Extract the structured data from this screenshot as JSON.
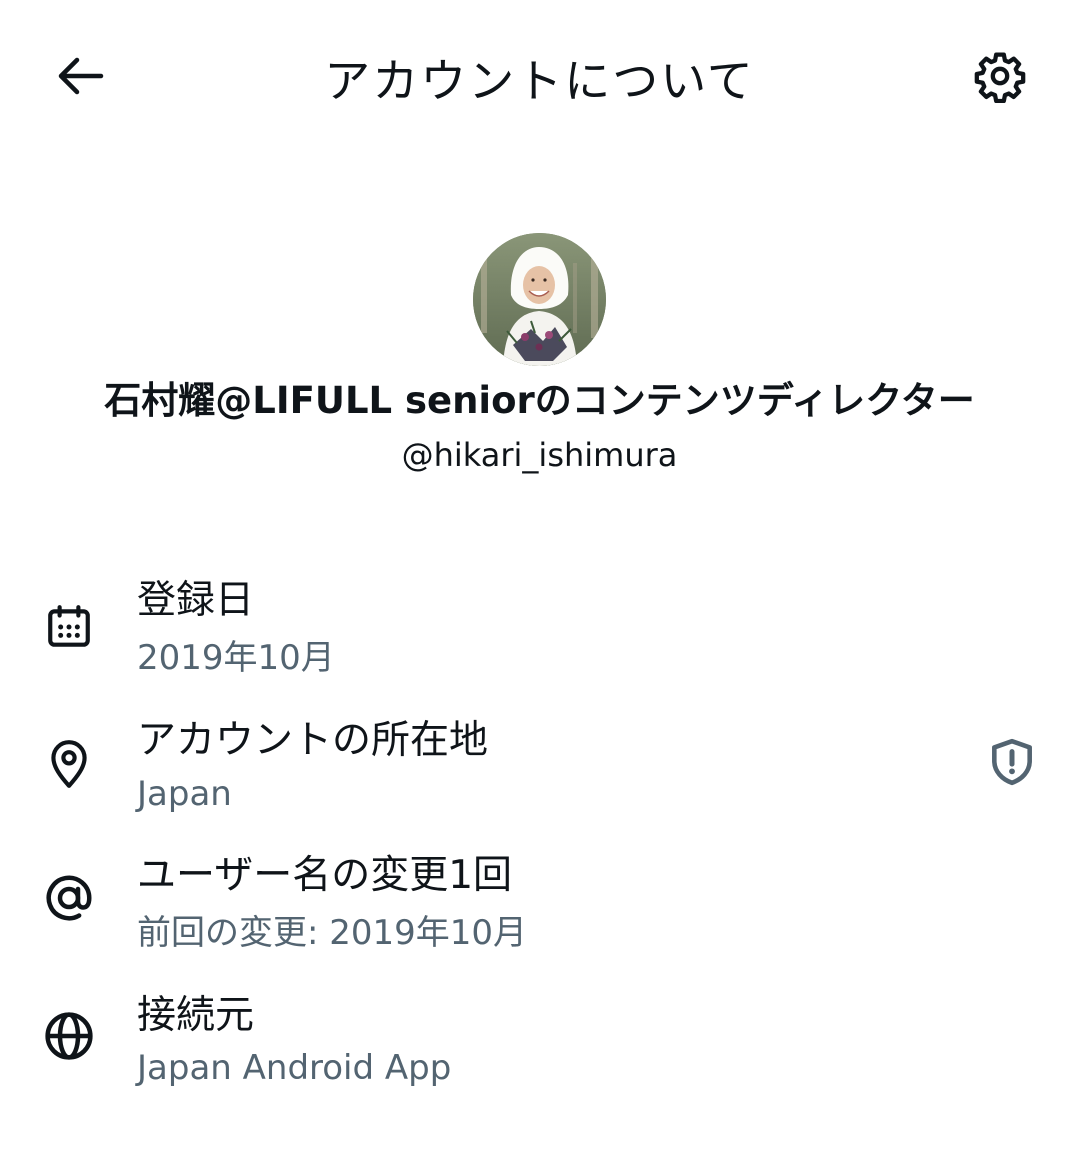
{
  "header": {
    "title": "アカウントについて",
    "back_icon": "arrow-left-icon",
    "settings_icon": "gear-icon"
  },
  "profile": {
    "display_name": "石村耀@LIFULL seniorのコンテンツディレクター",
    "handle": "@hikari_ishimura"
  },
  "info": [
    {
      "icon": "calendar-icon",
      "title": "登録日",
      "subtitle": "2019年10月"
    },
    {
      "icon": "location-pin-icon",
      "title": "アカウントの所在地",
      "subtitle": "Japan",
      "trailing_icon": "shield-alert-icon"
    },
    {
      "icon": "at-sign-icon",
      "title": "ユーザー名の変更1回",
      "subtitle": "前回の変更: 2019年10月"
    },
    {
      "icon": "globe-icon",
      "title": "接続元",
      "subtitle": "Japan Android App"
    }
  ],
  "colors": {
    "primary_text": "#0f1419",
    "secondary_text": "#536471",
    "background": "#ffffff"
  }
}
